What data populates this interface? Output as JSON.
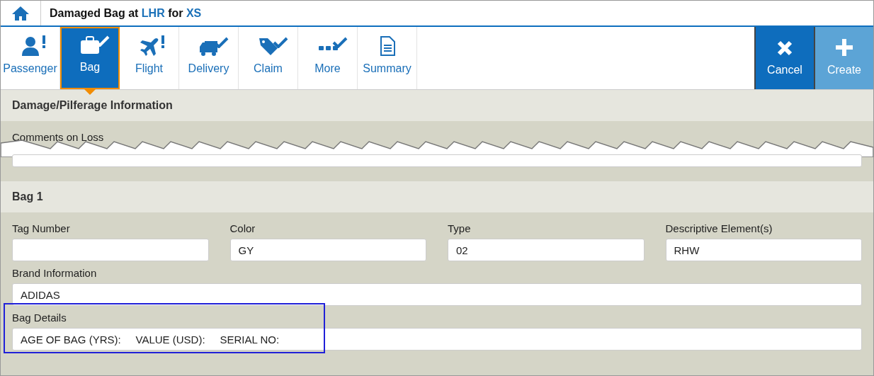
{
  "header": {
    "title": "Damaged Bag at **LHR** for **XS**"
  },
  "tabs": [
    {
      "label": "Passenger",
      "kind": "person",
      "alert": true,
      "done": false,
      "selected": false
    },
    {
      "label": "Bag",
      "kind": "bag",
      "alert": false,
      "done": true,
      "selected": true
    },
    {
      "label": "Flight",
      "kind": "plane",
      "alert": true,
      "done": false,
      "selected": false
    },
    {
      "label": "Delivery",
      "kind": "truck",
      "alert": false,
      "done": true,
      "selected": false
    },
    {
      "label": "Claim",
      "kind": "tag",
      "alert": false,
      "done": true,
      "selected": false
    },
    {
      "label": "More",
      "kind": "dots",
      "alert": false,
      "done": true,
      "selected": false
    },
    {
      "label": "Summary",
      "kind": "document",
      "alert": false,
      "done": false,
      "selected": false
    }
  ],
  "actions": [
    {
      "label": "Cancel",
      "kind": "cancel",
      "disabled": false
    },
    {
      "label": "Create",
      "kind": "create",
      "disabled": true
    }
  ],
  "sections": [
    {
      "title": "Damage/Pilferage Information",
      "torn": true,
      "rows": [
        [
          {
            "label": "Comments on Loss"
          }
        ]
      ]
    },
    {
      "title": "Bag 1",
      "rows": [
        [
          {
            "label": "Tag Number"
          },
          {
            "label": "Color",
            "value": "GY"
          },
          {
            "label": "Type",
            "value": "02"
          },
          {
            "label": "Descriptive Element(s)",
            "value": "RHW"
          }
        ],
        [
          {
            "label": "Brand Information",
            "value": "ADIDAS"
          }
        ],
        [
          {
            "label": "Bag Details",
            "value": "AGE OF BAG (YRS):     VALUE (USD):     SERIAL NO:",
            "highlighted": true
          }
        ]
      ]
    }
  ]
}
